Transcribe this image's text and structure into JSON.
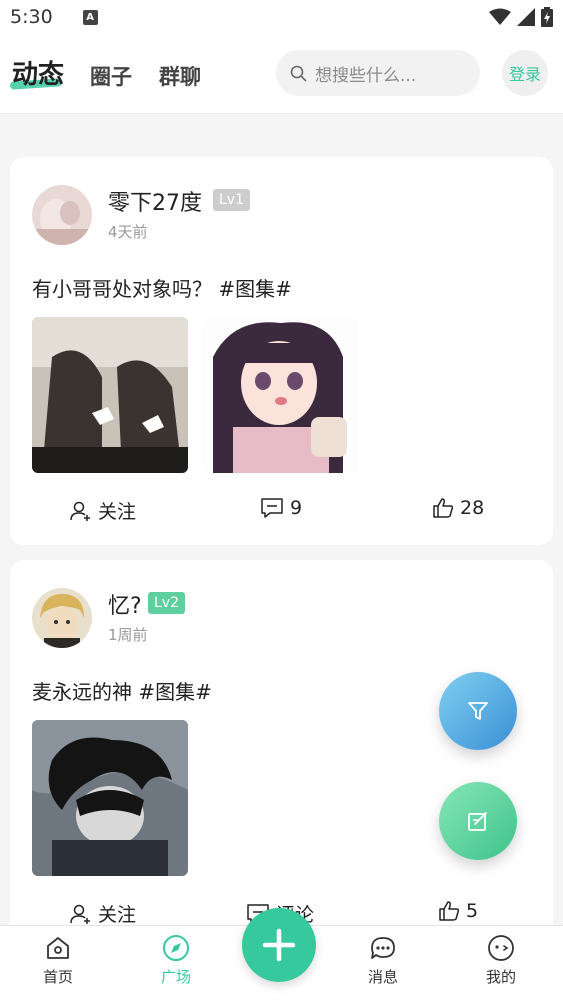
{
  "status_bar": {
    "time": "5:30",
    "badge": "A"
  },
  "header": {
    "tabs": [
      {
        "label": "动态",
        "active": true
      },
      {
        "label": "圈子",
        "active": false
      },
      {
        "label": "群聊",
        "active": false
      }
    ],
    "search": {
      "placeholder": "想搜些什么..."
    },
    "login_label": "登录",
    "accent_color": "#37c99e"
  },
  "posts": [
    {
      "username": "零下27度",
      "level": "Lv1",
      "level_color": "#c9c9c9",
      "time": "4天前",
      "text": "有小哥哥处对象吗？ #图集#",
      "actions": {
        "follow": "关注",
        "comments": "9",
        "likes": "28"
      }
    },
    {
      "username": "忆?",
      "level": "Lv2",
      "level_color": "#5fcf9f",
      "time": "1周前",
      "text": "麦永远的神 #图集#",
      "actions": {
        "follow": "关注",
        "comments": "评论",
        "likes": "5"
      }
    }
  ],
  "fabs": [
    {
      "name": "filter",
      "icon": "filter-icon"
    },
    {
      "name": "edit",
      "icon": "edit-icon"
    }
  ],
  "bottom_nav": [
    {
      "label": "首页",
      "icon": "home-icon",
      "active": false
    },
    {
      "label": "广场",
      "icon": "compass-icon",
      "active": true
    },
    {
      "label": "",
      "icon": "plus-icon",
      "active": false
    },
    {
      "label": "消息",
      "icon": "message-icon",
      "active": false
    },
    {
      "label": "我的",
      "icon": "profile-icon",
      "active": false
    }
  ]
}
